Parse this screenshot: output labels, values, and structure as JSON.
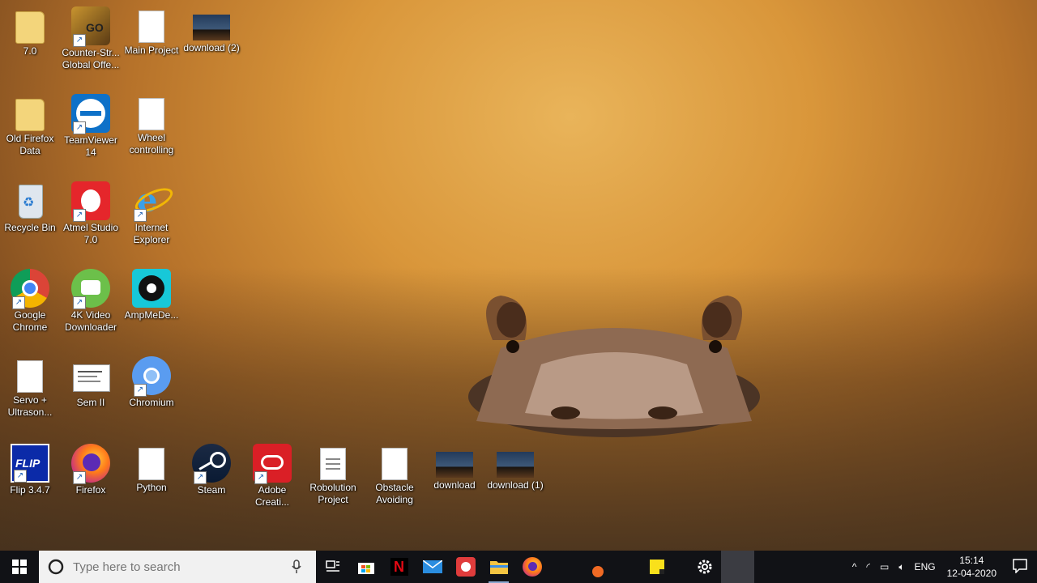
{
  "desktop": {
    "icons": [
      {
        "label": "7.0",
        "icon": "folder-icon"
      },
      {
        "label": "Counter-Str...\nGlobal Offe...",
        "icon": "csgo-icon"
      },
      {
        "label": "Main Project",
        "icon": "document-icon"
      },
      {
        "label": "download (2)",
        "icon": "image-file-icon"
      },
      {
        "label": "Old Firefox\nData",
        "icon": "folder-icon"
      },
      {
        "label": "TeamViewer\n14",
        "icon": "teamviewer-icon"
      },
      {
        "label": "Wheel\ncontrolling",
        "icon": "document-icon"
      },
      {
        "label": "Recycle Bin",
        "icon": "recycle-bin-icon"
      },
      {
        "label": "Atmel Studio\n7.0",
        "icon": "atmel-studio-icon"
      },
      {
        "label": "Internet\nExplorer",
        "icon": "internet-explorer-icon"
      },
      {
        "label": "Google\nChrome",
        "icon": "chrome-icon"
      },
      {
        "label": "4K Video\nDownloader",
        "icon": "4k-video-downloader-icon"
      },
      {
        "label": "AmpMeDe...",
        "icon": "ampme-icon"
      },
      {
        "label": "Servo +\nUltrason...",
        "icon": "document-icon"
      },
      {
        "label": "Sem II",
        "icon": "document-thumbnail-icon"
      },
      {
        "label": "Chromium",
        "icon": "chromium-icon"
      },
      {
        "label": "Flip 3.4.7",
        "icon": "atmel-flip-icon"
      },
      {
        "label": "Firefox",
        "icon": "firefox-icon"
      },
      {
        "label": "Python",
        "icon": "document-icon"
      },
      {
        "label": "Steam",
        "icon": "steam-icon"
      },
      {
        "label": "Adobe\nCreati...",
        "icon": "adobe-creative-cloud-icon"
      },
      {
        "label": "Robolution\nProject",
        "icon": "document-icon"
      },
      {
        "label": "Obstacle\nAvoiding",
        "icon": "document-icon"
      },
      {
        "label": "download",
        "icon": "image-file-icon"
      },
      {
        "label": "download (1)",
        "icon": "image-file-icon"
      }
    ]
  },
  "taskbar": {
    "search_placeholder": "Type here to search",
    "apps": [
      "task-view-icon",
      "microsoft-store-icon",
      "netflix-icon",
      "mail-icon",
      "raspberry-pi-icon",
      "file-explorer-icon",
      "firefox-icon",
      "unknown-orange-app-icon",
      "sticky-notes-icon",
      "settings-icon"
    ],
    "language": "ENG",
    "time": "15:14",
    "date": "12-04-2020"
  },
  "colors": {
    "taskbar": "#111216",
    "accent": "#8aa7cf",
    "wallpaper": "#d9963a"
  }
}
